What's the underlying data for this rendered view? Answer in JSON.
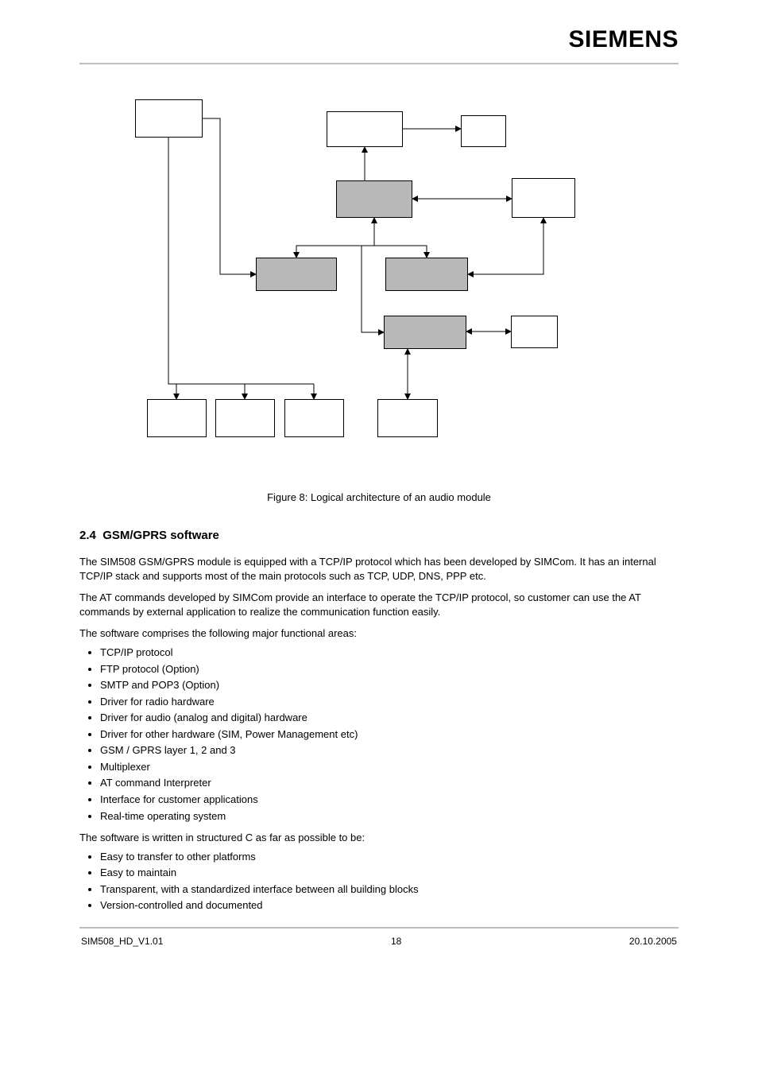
{
  "brand": "SIEMENS",
  "figure_caption": "Figure 8: Logical architecture of an audio module",
  "section_number": "2.4",
  "section_title": "GSM/GPRS software",
  "body_p1": "The SIM508 GSM/GPRS module is equipped with a TCP/IP protocol which has been developed by SIMCom. It has an internal TCP/IP stack and supports most of the main protocols such as TCP, UDP, DNS, PPP etc.",
  "body_p2": "The AT commands developed by SIMCom provide an interface to operate the TCP/IP protocol, so customer can use the AT commands by external application to realize the communication function easily.",
  "list1_intro": "The software comprises the following major functional areas:",
  "list1": [
    "TCP/IP protocol",
    "FTP protocol (Option)",
    "SMTP and POP3 (Option)",
    "Driver for radio hardware",
    "Driver for audio (analog and digital) hardware",
    "Driver for other hardware (SIM, Power Management etc)",
    "GSM / GPRS layer 1, 2 and 3",
    "Multiplexer",
    "AT command Interpreter",
    "Interface for customer applications",
    "Real-time operating system"
  ],
  "list2_intro": "The software is written in structured C as far as possible to be:",
  "list2": [
    "Easy to transfer to other platforms",
    "Easy to maintain",
    "Transparent, with a standardized interface between all building blocks",
    "Version-controlled and documented"
  ],
  "footer_left": "SIM508_HD_V1.01",
  "footer_center": "18",
  "footer_right": "20.10.2005"
}
